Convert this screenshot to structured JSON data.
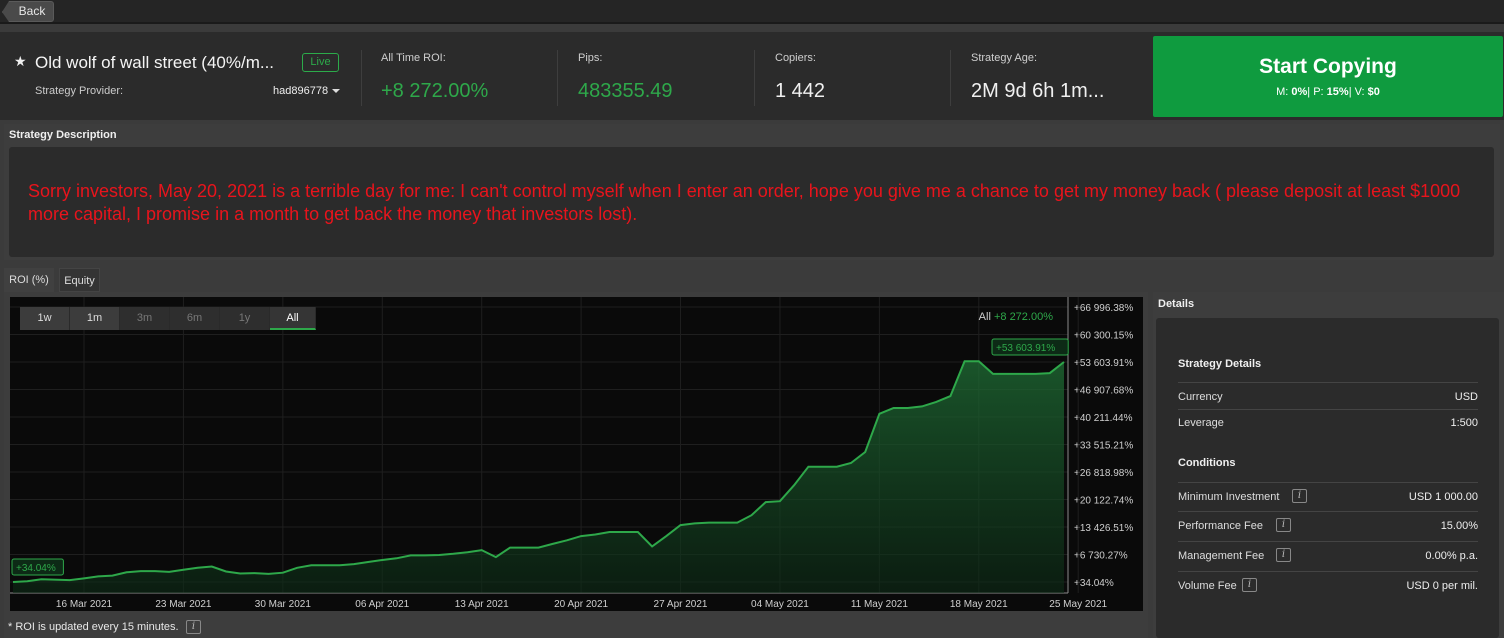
{
  "nav": {
    "back_label": "Back"
  },
  "header": {
    "strategy_name": "Old wolf of wall street (40%/m...",
    "live_badge": "Live",
    "provider_label": "Strategy Provider:",
    "provider_value": "had896778",
    "stats": [
      {
        "label": "All Time ROI:",
        "value": "+8 272.00%"
      },
      {
        "label": "Pips:",
        "value": "483355.49"
      },
      {
        "label": "Copiers:",
        "value": "1 442"
      },
      {
        "label": "Strategy Age:",
        "value": "2M 9d 6h 1m..."
      }
    ],
    "start_button": {
      "label": "Start Copying",
      "m_label": "M:",
      "m_value": "0%",
      "p_label": "P:",
      "p_value": "15%",
      "v_label": "V:",
      "v_value": "$0"
    }
  },
  "description": {
    "title": "Strategy Description",
    "text": "Sorry investors, May 20, 2021 is a terrible day for me: I can't control myself when I enter an order, hope you give me a chance to get my money back ( please deposit at least $1000 more capital, I promise in a month to get back the money that investors lost)."
  },
  "tabs": [
    {
      "label": "ROI (%)"
    },
    {
      "label": "Equity"
    }
  ],
  "chart_controls": {
    "ranges": [
      "1w",
      "1m",
      "3m",
      "6m",
      "1y",
      "All"
    ],
    "all_label": "All",
    "all_value": "+8 272.00%",
    "start_badge": "+34.04%",
    "end_badge": "+53 603.91%"
  },
  "chart_data": {
    "type": "area",
    "x_tick_labels": [
      "16 Mar 2021",
      "23 Mar 2021",
      "30 Mar 2021",
      "06 Apr 2021",
      "13 Apr 2021",
      "20 Apr 2021",
      "27 Apr 2021",
      "04 May 2021",
      "11 May 2021",
      "18 May 2021",
      "25 May 2021"
    ],
    "y_tick_labels": [
      "+66 996.38%",
      "+60 300.15%",
      "+53 603.91%",
      "+46 907.68%",
      "+40 211.44%",
      "+33 515.21%",
      "+26 818.98%",
      "+20 122.74%",
      "+13 426.51%",
      "+6 730.27%",
      "+34.04%"
    ],
    "ylim": [
      34.04,
      66996.38
    ],
    "grid": true,
    "series": [
      {
        "color": "#2ea84a",
        "points": [
          [
            "2021-03-11",
            34.04
          ],
          [
            "2021-03-12",
            200
          ],
          [
            "2021-03-13",
            700
          ],
          [
            "2021-03-15",
            500
          ],
          [
            "2021-03-16",
            900
          ],
          [
            "2021-03-17",
            1400
          ],
          [
            "2021-03-18",
            1600
          ],
          [
            "2021-03-19",
            2400
          ],
          [
            "2021-03-20",
            2700
          ],
          [
            "2021-03-21",
            2700
          ],
          [
            "2021-03-22",
            2500
          ],
          [
            "2021-03-23",
            3000
          ],
          [
            "2021-03-24",
            3500
          ],
          [
            "2021-03-25",
            3800
          ],
          [
            "2021-03-26",
            2600
          ],
          [
            "2021-03-27",
            2100
          ],
          [
            "2021-03-28",
            2200
          ],
          [
            "2021-03-29",
            2000
          ],
          [
            "2021-03-30",
            2300
          ],
          [
            "2021-03-31",
            3500
          ],
          [
            "2021-04-01",
            4100
          ],
          [
            "2021-04-02",
            4100
          ],
          [
            "2021-04-03",
            4100
          ],
          [
            "2021-04-04",
            4400
          ],
          [
            "2021-04-05",
            4900
          ],
          [
            "2021-04-06",
            5400
          ],
          [
            "2021-04-07",
            5800
          ],
          [
            "2021-04-08",
            6500
          ],
          [
            "2021-04-09",
            6500
          ],
          [
            "2021-04-10",
            6600
          ],
          [
            "2021-04-11",
            6900
          ],
          [
            "2021-04-12",
            7300
          ],
          [
            "2021-04-13",
            7800
          ],
          [
            "2021-04-14",
            6100
          ],
          [
            "2021-04-15",
            8400
          ],
          [
            "2021-04-16",
            8400
          ],
          [
            "2021-04-17",
            8400
          ],
          [
            "2021-04-18",
            9300
          ],
          [
            "2021-04-19",
            10200
          ],
          [
            "2021-04-20",
            11200
          ],
          [
            "2021-04-21",
            11600
          ],
          [
            "2021-04-22",
            12200
          ],
          [
            "2021-04-23",
            12200
          ],
          [
            "2021-04-24",
            12200
          ],
          [
            "2021-04-25",
            8700
          ],
          [
            "2021-04-26",
            11200
          ],
          [
            "2021-04-27",
            13900
          ],
          [
            "2021-04-28",
            14300
          ],
          [
            "2021-04-29",
            14500
          ],
          [
            "2021-04-30",
            14500
          ],
          [
            "2021-05-01",
            14500
          ],
          [
            "2021-05-02",
            16300
          ],
          [
            "2021-05-03",
            19500
          ],
          [
            "2021-05-04",
            19700
          ],
          [
            "2021-05-05",
            23600
          ],
          [
            "2021-05-06",
            28100
          ],
          [
            "2021-05-07",
            28100
          ],
          [
            "2021-05-08",
            28100
          ],
          [
            "2021-05-09",
            29000
          ],
          [
            "2021-05-10",
            31700
          ],
          [
            "2021-05-11",
            41000
          ],
          [
            "2021-05-12",
            42400
          ],
          [
            "2021-05-13",
            42400
          ],
          [
            "2021-05-14",
            42800
          ],
          [
            "2021-05-15",
            43900
          ],
          [
            "2021-05-16",
            45300
          ],
          [
            "2021-05-17",
            53800
          ],
          [
            "2021-05-18",
            53800
          ],
          [
            "2021-05-19",
            50700
          ],
          [
            "2021-05-20",
            50700
          ],
          [
            "2021-05-21",
            50700
          ],
          [
            "2021-05-22",
            50700
          ],
          [
            "2021-05-23",
            50900
          ],
          [
            "2021-05-24",
            53603.91
          ]
        ]
      }
    ]
  },
  "footnote": "* ROI is updated every 15 minutes.",
  "details": {
    "title": "Details",
    "strategy_details_title": "Strategy Details",
    "strategy_rows": [
      {
        "label": "Currency",
        "value": "USD"
      },
      {
        "label": "Leverage",
        "value": "1:500"
      }
    ],
    "conditions_title": "Conditions",
    "condition_rows": [
      {
        "label": "Minimum Investment",
        "value": "USD 1 000.00"
      },
      {
        "label": "Performance Fee",
        "value": "15.00%"
      },
      {
        "label": "Management Fee",
        "value": "0.00% p.a."
      },
      {
        "label": "Volume Fee",
        "value": "USD 0 per mil."
      }
    ]
  }
}
